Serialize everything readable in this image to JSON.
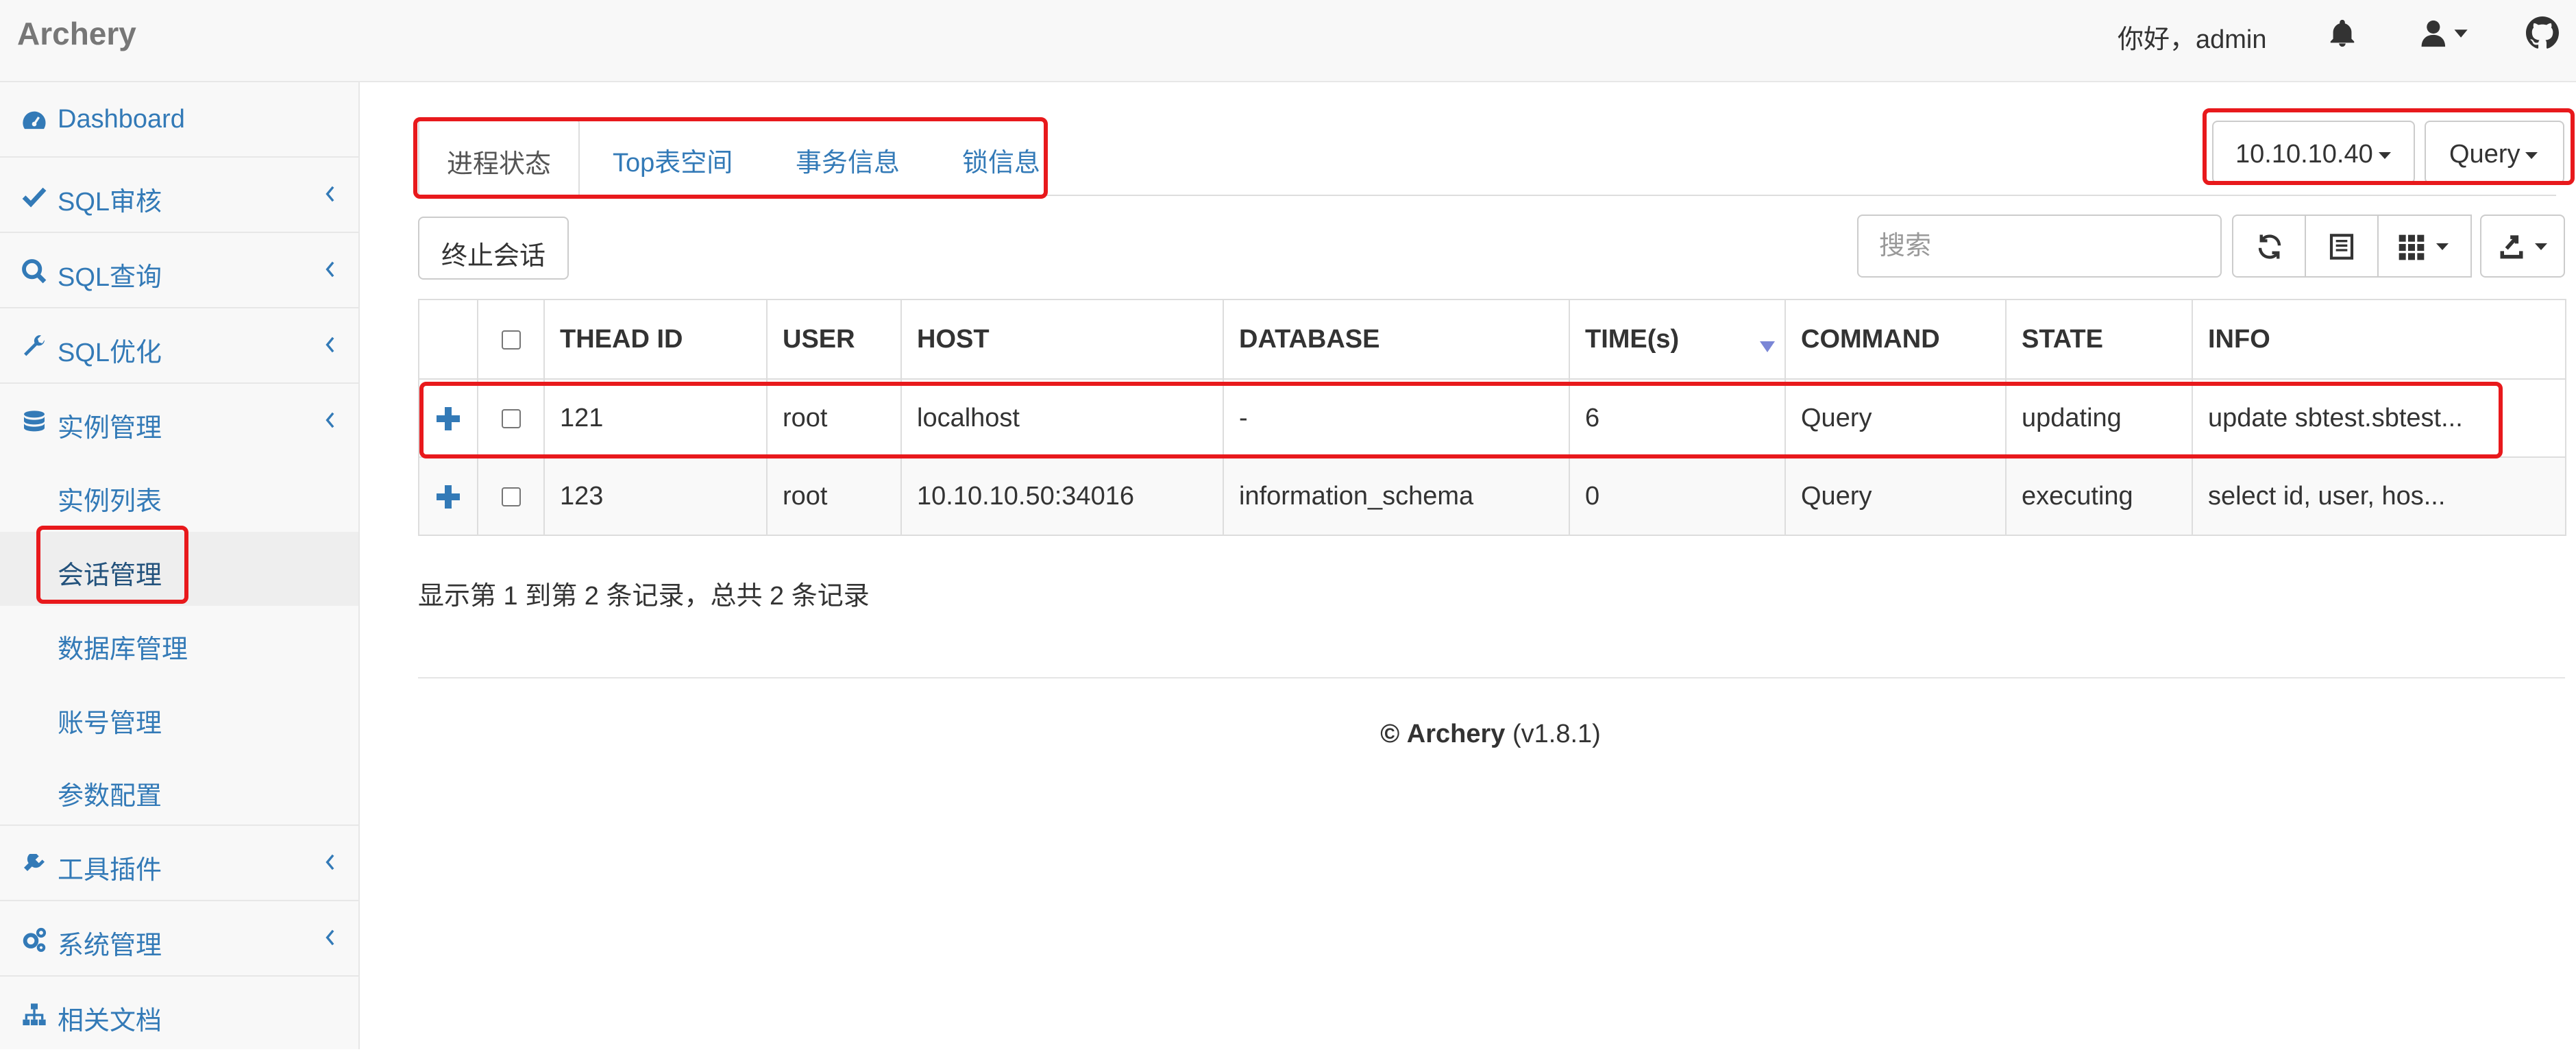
{
  "navbar": {
    "brand": "Archery",
    "greeting": "你好，admin"
  },
  "sidebar": {
    "items": [
      {
        "label": "Dashboard",
        "icon": "dashboard-icon"
      },
      {
        "label": "SQL审核",
        "icon": "check-icon"
      },
      {
        "label": "SQL查询",
        "icon": "search-icon"
      },
      {
        "label": "SQL优化",
        "icon": "wrench-icon"
      },
      {
        "label": "实例管理",
        "icon": "database-icon"
      },
      {
        "label": "工具插件",
        "icon": "plug-icon"
      },
      {
        "label": "系统管理",
        "icon": "cogs-icon"
      },
      {
        "label": "相关文档",
        "icon": "sitemap-icon"
      }
    ],
    "subitems": [
      {
        "label": "实例列表"
      },
      {
        "label": "会话管理"
      },
      {
        "label": "数据库管理"
      },
      {
        "label": "账号管理"
      },
      {
        "label": "参数配置"
      }
    ]
  },
  "tabs": [
    "进程状态",
    "Top表空间",
    "事务信息",
    "锁信息"
  ],
  "instance_select": "10.10.10.40",
  "command_select": "Query",
  "kill_button": "终止会话",
  "search": {
    "placeholder": "搜索"
  },
  "table": {
    "headers": [
      "THEAD ID",
      "USER",
      "HOST",
      "DATABASE",
      "TIME(s)",
      "COMMAND",
      "STATE",
      "INFO"
    ],
    "rows": [
      [
        "121",
        "root",
        "localhost",
        "-",
        "6",
        "Query",
        "updating",
        "update sbtest.sbtest..."
      ],
      [
        "123",
        "root",
        "10.10.10.50:34016",
        "information_schema",
        "0",
        "Query",
        "executing",
        "select id, user, hos..."
      ]
    ]
  },
  "pagination_text": "显示第 1 到第 2 条记录，总共 2 条记录",
  "footer": {
    "copyright": "©",
    "name": "Archery",
    "version": "(v1.8.1)"
  },
  "colors": {
    "link": "#337ab7",
    "highlight": "#e8191c"
  }
}
